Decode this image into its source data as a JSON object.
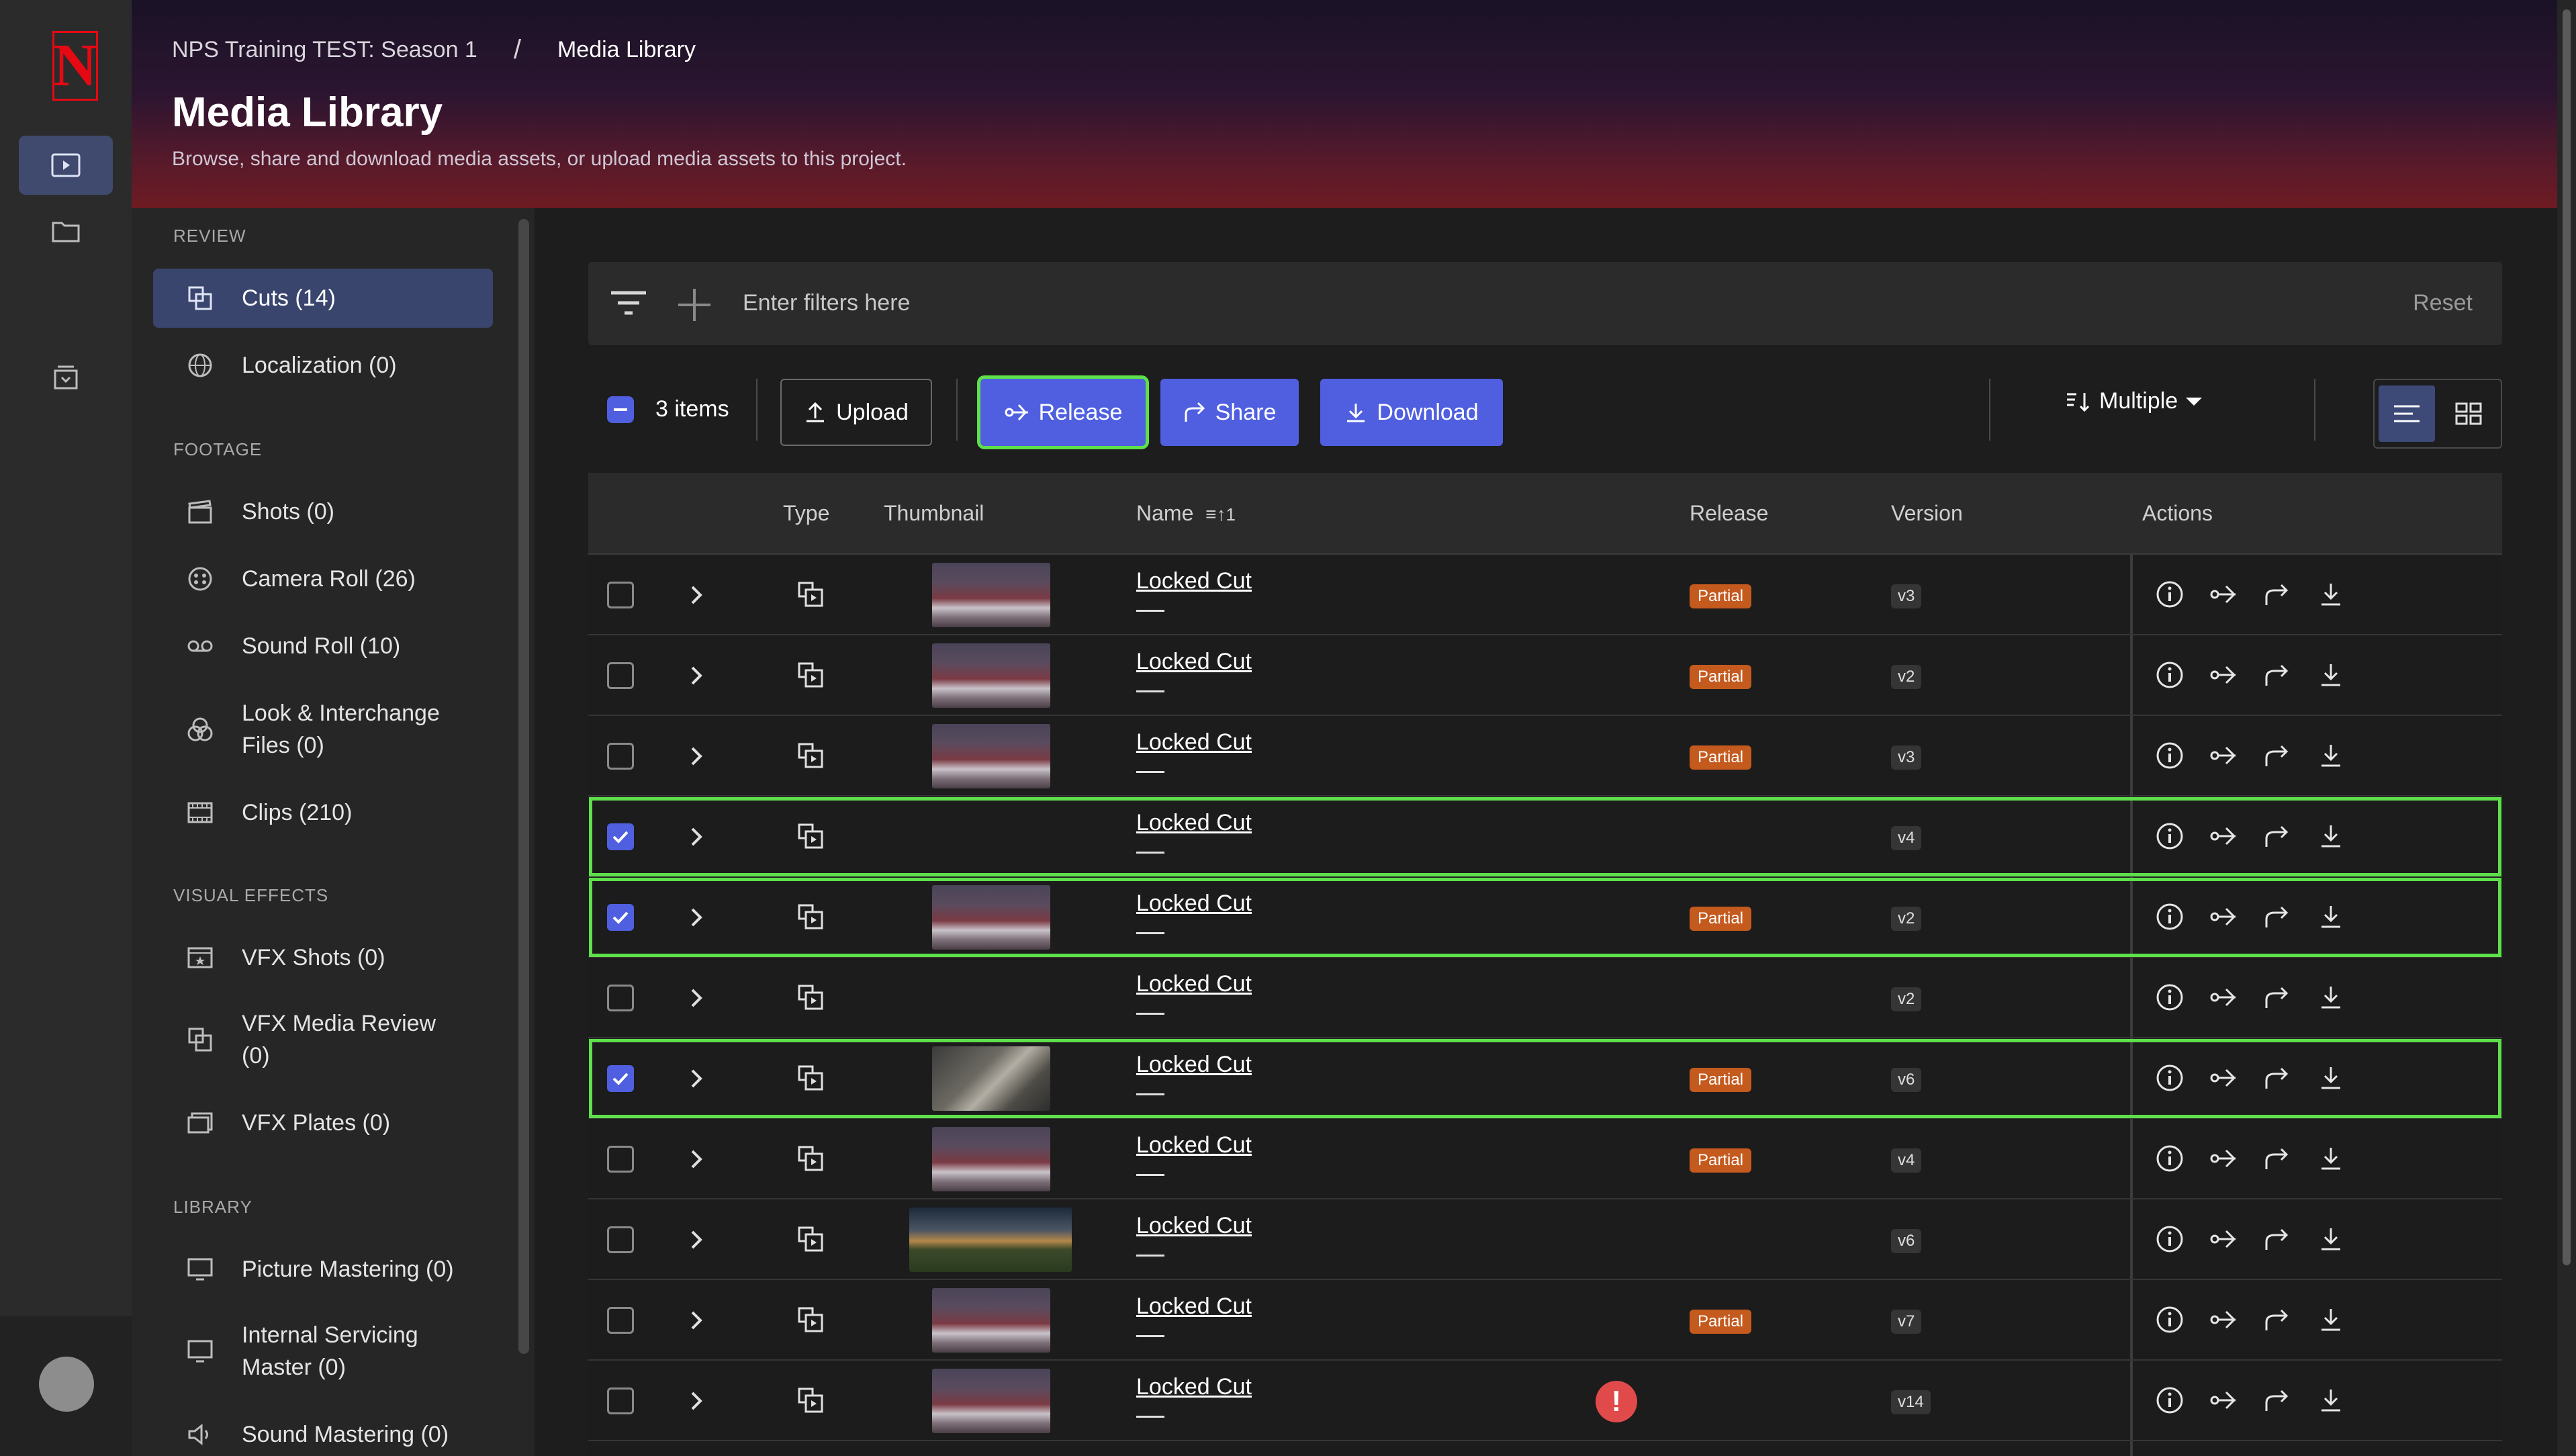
{
  "app": {
    "logo_letter": "N",
    "brand_color": "#e50914"
  },
  "rail": {
    "items": [
      {
        "icon": "play-square-icon"
      },
      {
        "icon": "folder-icon"
      },
      {
        "icon": "inbox-icon"
      }
    ]
  },
  "header": {
    "breadcrumb_project": "NPS Training TEST: Season 1",
    "breadcrumb_sep": "/",
    "breadcrumb_current": "Media Library",
    "title": "Media Library",
    "subtitle": "Browse, share and download media assets, or upload media assets to this project."
  },
  "sidebar": {
    "sections": {
      "review": "REVIEW",
      "footage": "FOOTAGE",
      "vfx": "VISUAL EFFECTS",
      "library": "LIBRARY"
    },
    "items": {
      "cuts": "Cuts (14)",
      "localization": "Localization (0)",
      "shots": "Shots (0)",
      "camera_roll": "Camera Roll (26)",
      "sound_roll": "Sound Roll (10)",
      "look_line1": "Look & Interchange",
      "look_line2": "Files (0)",
      "clips": "Clips (210)",
      "vfx_shots": "VFX Shots (0)",
      "vfx_review_line1": "VFX Media Review",
      "vfx_review_line2": "(0)",
      "vfx_plates": "VFX Plates (0)",
      "picture_mastering": "Picture Mastering (0)",
      "internal_line1": "Internal Servicing",
      "internal_line2": "Master (0)",
      "sound_mastering": "Sound Mastering (0)"
    }
  },
  "filters": {
    "placeholder": "Enter filters here",
    "reset": "Reset"
  },
  "toolbar": {
    "selected_count": "3 items",
    "upload": "Upload",
    "release": "Release",
    "share": "Share",
    "download": "Download",
    "sort": "Multiple"
  },
  "table": {
    "headers": {
      "type": "Type",
      "thumbnail": "Thumbnail",
      "name": "Name",
      "name_sort": "1",
      "release": "Release",
      "version": "Version",
      "actions": "Actions"
    },
    "rows": [
      {
        "selected": false,
        "thumb": "a",
        "name": "Locked Cut",
        "sub": "—",
        "release": "Partial",
        "version": "v3",
        "warn": ""
      },
      {
        "selected": false,
        "thumb": "a",
        "name": "Locked Cut",
        "sub": "—",
        "release": "Partial",
        "version": "v2",
        "warn": ""
      },
      {
        "selected": false,
        "thumb": "a",
        "name": "Locked Cut",
        "sub": "—",
        "release": "Partial",
        "version": "v3",
        "warn": ""
      },
      {
        "selected": true,
        "thumb": "",
        "name": "Locked Cut",
        "sub": "—",
        "release": "",
        "version": "v4",
        "warn": ""
      },
      {
        "selected": true,
        "thumb": "a",
        "name": "Locked Cut",
        "sub": "—",
        "release": "Partial",
        "version": "v2",
        "warn": ""
      },
      {
        "selected": false,
        "thumb": "",
        "name": "Locked Cut",
        "sub": "—",
        "release": "",
        "version": "v2",
        "warn": ""
      },
      {
        "selected": true,
        "thumb": "b",
        "name": "Locked Cut",
        "sub": "—",
        "release": "Partial",
        "version": "v6",
        "warn": ""
      },
      {
        "selected": false,
        "thumb": "a",
        "name": "Locked Cut",
        "sub": "—",
        "release": "Partial",
        "version": "v4",
        "warn": ""
      },
      {
        "selected": false,
        "thumb": "c",
        "name": "Locked Cut",
        "sub": "—",
        "release": "",
        "version": "v6",
        "warn": ""
      },
      {
        "selected": false,
        "thumb": "a",
        "name": "Locked Cut",
        "sub": "—",
        "release": "Partial",
        "version": "v7",
        "warn": ""
      },
      {
        "selected": false,
        "thumb": "a",
        "name": "Locked Cut",
        "sub": "—",
        "release": "",
        "version": "v14",
        "warn": "!"
      }
    ]
  },
  "colors": {
    "accent": "#4f5fe0",
    "selection_outline": "#5ee04a",
    "partial_badge": "#c45a1e",
    "warning": "#e04a4a"
  }
}
